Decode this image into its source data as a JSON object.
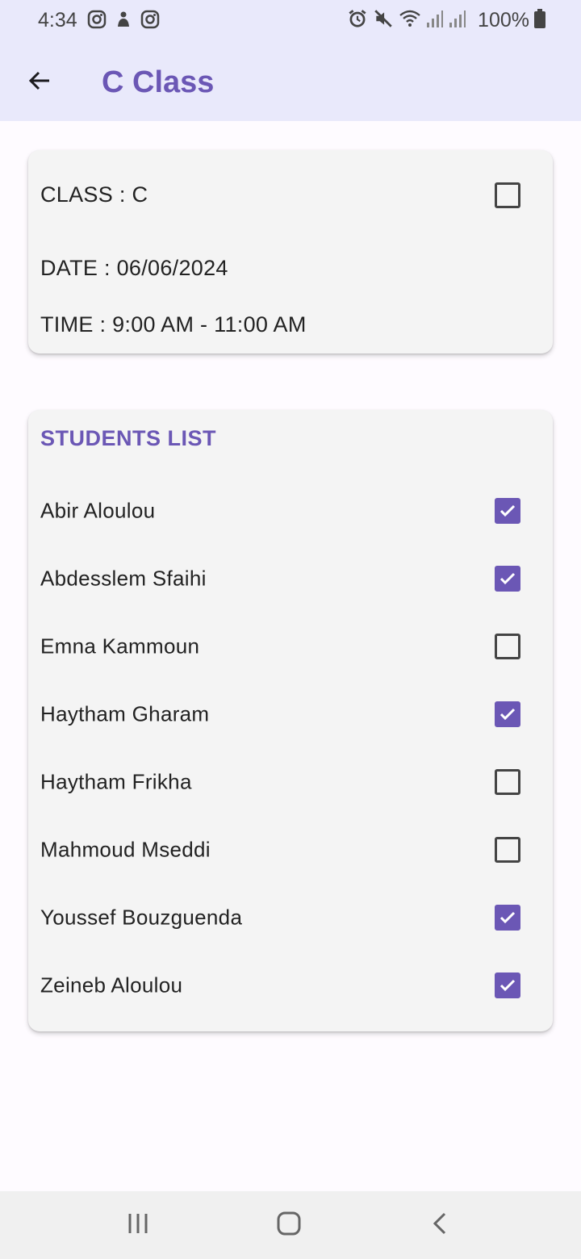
{
  "status_bar": {
    "time": "4:34",
    "battery": "100%"
  },
  "app_bar": {
    "title": "C Class"
  },
  "class_info": {
    "class_line": "CLASS : C",
    "date_line": "DATE : 06/06/2024",
    "time_line": "TIME : 9:00 AM - 11:00 AM",
    "checked": false
  },
  "students": {
    "title": "STUDENTS LIST",
    "items": [
      {
        "name": "Abir Aloulou",
        "checked": true
      },
      {
        "name": "Abdesslem Sfaihi",
        "checked": true
      },
      {
        "name": "Emna Kammoun",
        "checked": false
      },
      {
        "name": "Haytham Gharam",
        "checked": true
      },
      {
        "name": "Haytham Frikha",
        "checked": false
      },
      {
        "name": "Mahmoud Mseddi",
        "checked": false
      },
      {
        "name": "Youssef Bouzguenda",
        "checked": true
      },
      {
        "name": "Zeineb Aloulou",
        "checked": true
      }
    ]
  },
  "colors": {
    "accent": "#6b57b5",
    "app_bar_bg": "#e9e9fb",
    "card_bg": "#f4f4f4"
  }
}
